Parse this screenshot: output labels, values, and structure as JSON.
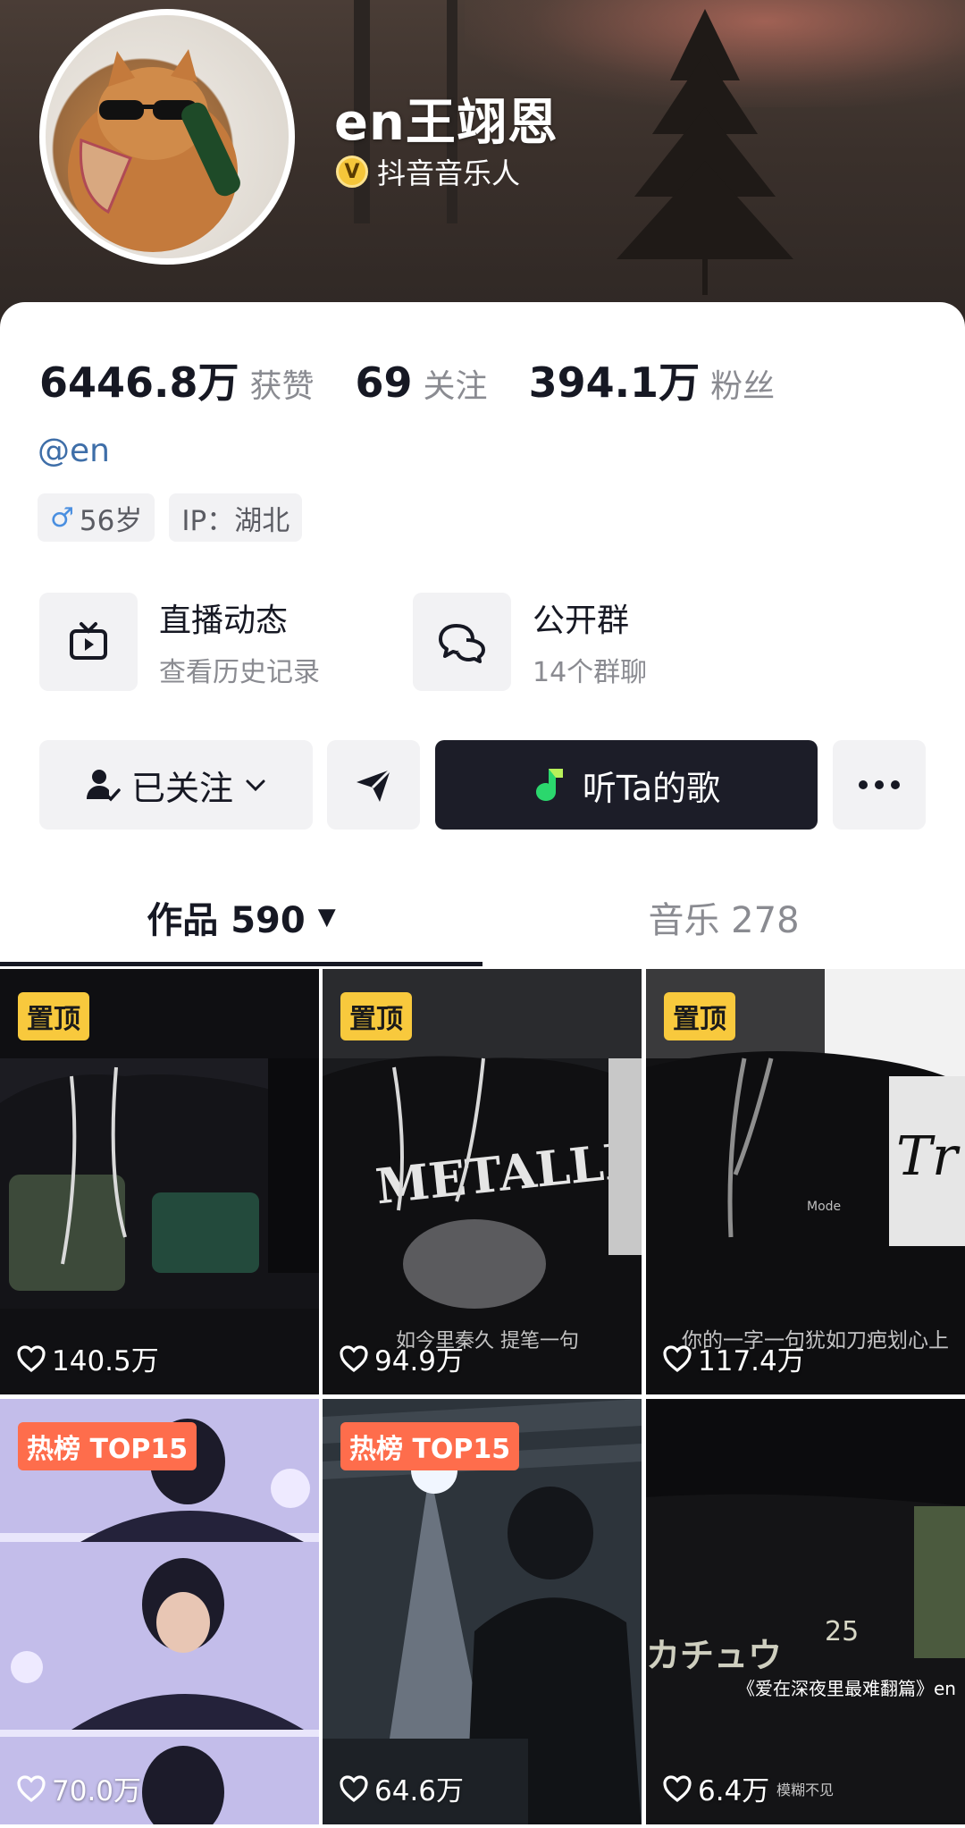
{
  "profile": {
    "name": "en王翊恩",
    "verify_label": "抖音音乐人",
    "verify_glyph": "V",
    "handle": "@en",
    "age": "56岁",
    "ip": "IP：湖北"
  },
  "stats": [
    {
      "num": "6446.8万",
      "label": "获赞"
    },
    {
      "num": "69",
      "label": "关注"
    },
    {
      "num": "394.1万",
      "label": "粉丝"
    }
  ],
  "info_cards": [
    {
      "title": "直播动态",
      "sub": "查看历史记录",
      "icon": "tv-icon"
    },
    {
      "title": "公开群",
      "sub": "14个群聊",
      "icon": "chat-bubbles-icon"
    }
  ],
  "actions": {
    "follow_label": "已关注",
    "music_label": "听Ta的歌"
  },
  "tabs": {
    "works": "作品 590",
    "music": "音乐 278"
  },
  "videos": [
    {
      "badge": "置顶",
      "likes": "140.5万",
      "caption": ""
    },
    {
      "badge": "置顶",
      "likes": "94.9万",
      "caption": "如今里秦久 提笔一句"
    },
    {
      "badge": "置顶",
      "likes": "117.4万",
      "caption": "你的一字一句犹如刀疤划心上"
    },
    {
      "badge": "热榜 TOP15",
      "likes": "70.0万",
      "caption": ""
    },
    {
      "badge": "热榜 TOP15",
      "likes": "64.6万",
      "caption": ""
    },
    {
      "badge": "",
      "likes": "6.4万",
      "caption": "《爱在深夜里最难翻篇》en",
      "caption2": "模糊不见"
    }
  ],
  "colors": {
    "pin_badge": "#f8c93d",
    "hot_badge": "#fe6d4c",
    "music_button": "#1c1d28",
    "handle": "#3e6ea8"
  }
}
